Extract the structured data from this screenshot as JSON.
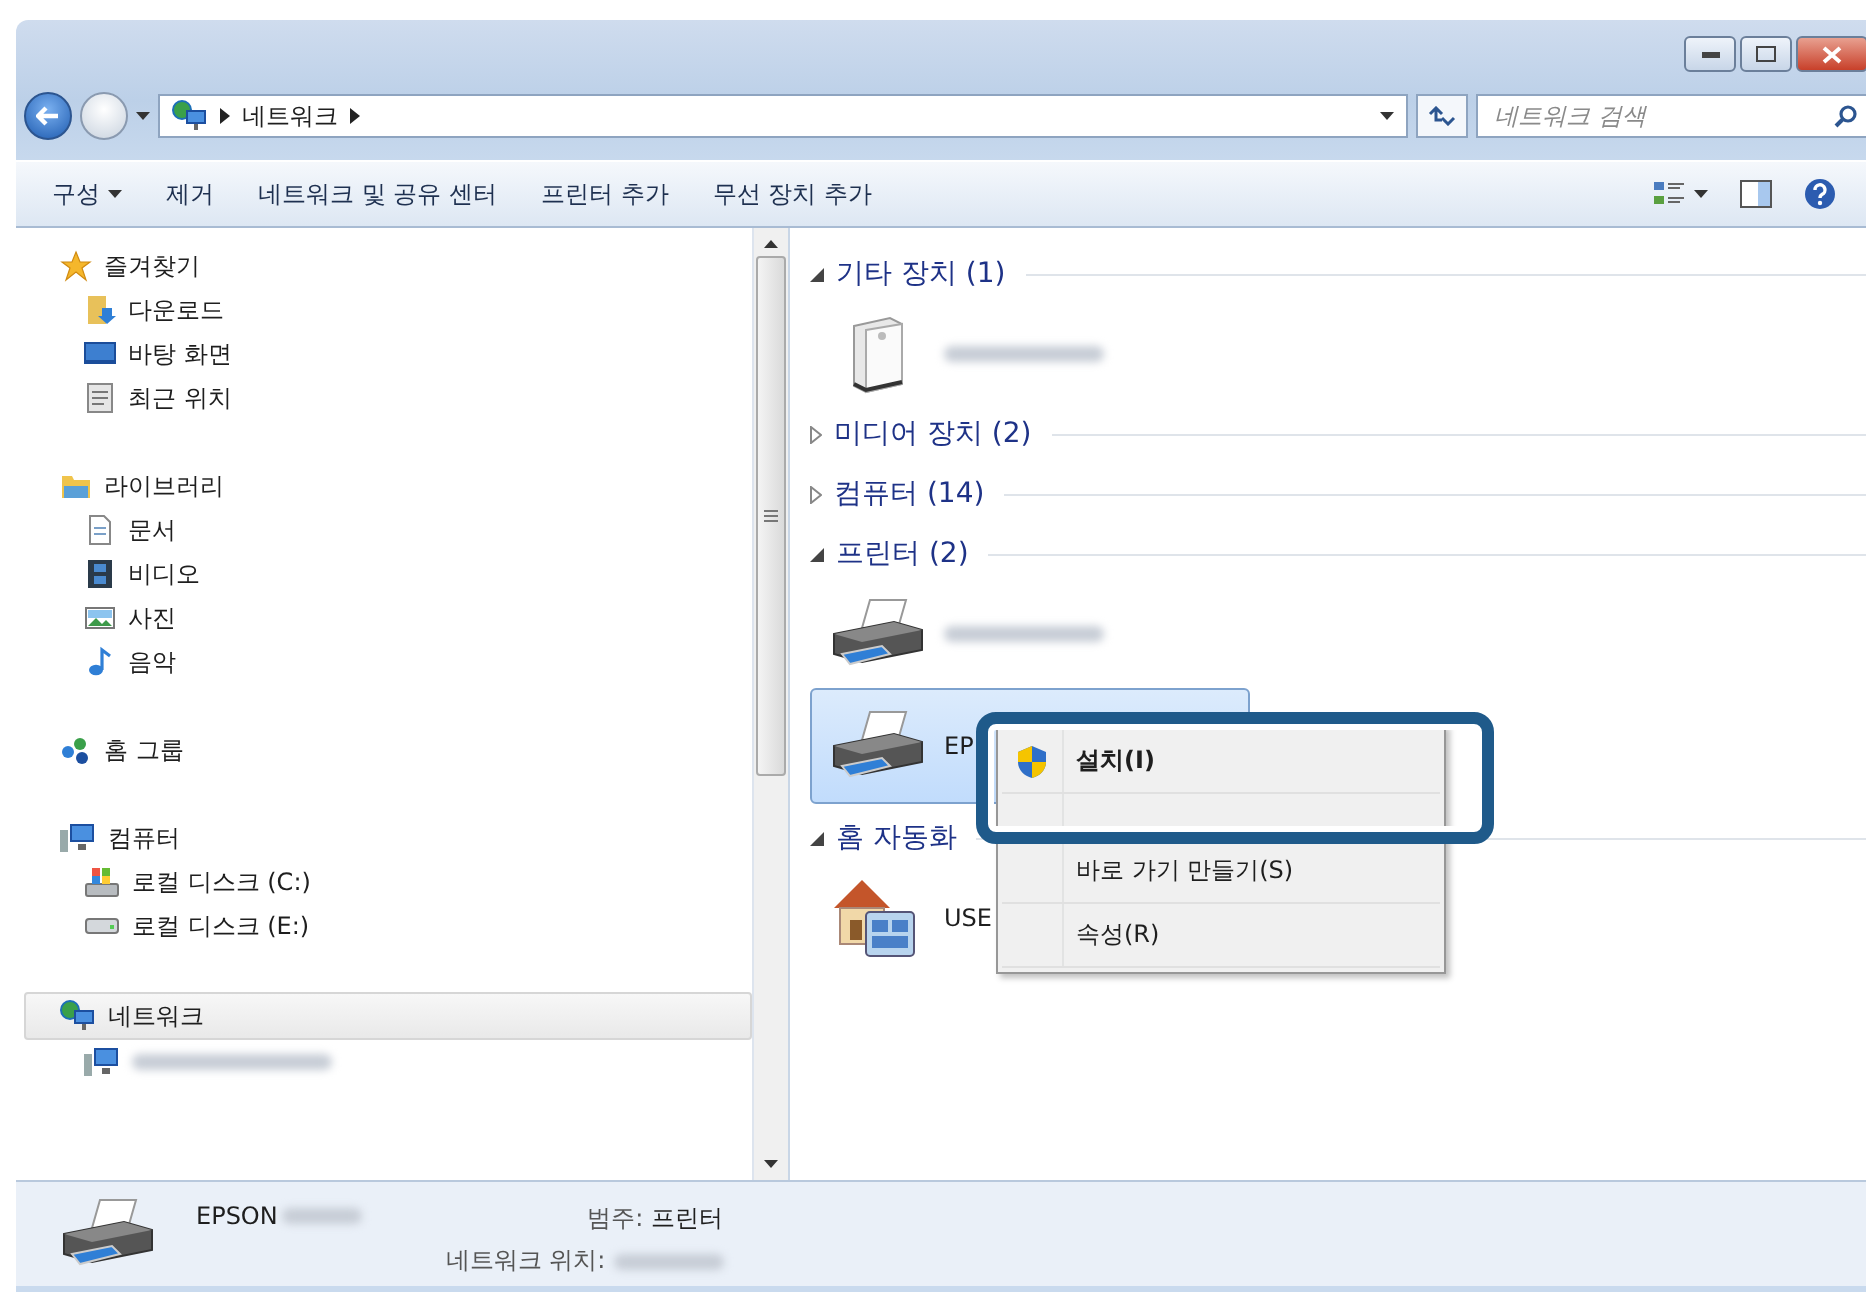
{
  "address": {
    "path": [
      "네트워크"
    ],
    "search_placeholder": "네트워크 검색"
  },
  "toolbar": [
    {
      "label": "구성",
      "has_menu": true
    },
    {
      "label": "제거",
      "has_menu": false
    },
    {
      "label": "네트워크 및 공유 센터",
      "has_menu": false
    },
    {
      "label": "프린터 추가",
      "has_menu": false
    },
    {
      "label": "무선 장치 추가",
      "has_menu": false
    }
  ],
  "navigation": [
    {
      "label": "즐겨찾기",
      "kind": "star",
      "selected": false,
      "children": [
        {
          "label": "다운로드",
          "kind": "download"
        },
        {
          "label": "바탕 화면",
          "kind": "desktop"
        },
        {
          "label": "최근 위치",
          "kind": "recent"
        }
      ]
    },
    {
      "label": "라이브러리",
      "kind": "library",
      "selected": false,
      "children": [
        {
          "label": "문서",
          "kind": "document"
        },
        {
          "label": "비디오",
          "kind": "video"
        },
        {
          "label": "사진",
          "kind": "picture"
        },
        {
          "label": "음악",
          "kind": "music"
        }
      ]
    },
    {
      "label": "홈 그룹",
      "kind": "homegroup",
      "selected": false
    },
    {
      "label": "컴퓨터",
      "kind": "computer",
      "selected": false,
      "children": [
        {
          "label": "로컬 디스크 (C:)",
          "kind": "systemdisk"
        },
        {
          "label": "로컬 디스크 (E:)",
          "kind": "disk"
        }
      ]
    },
    {
      "label": "네트워크",
      "kind": "network",
      "selected": true,
      "children": [
        {
          "kind": "computer",
          "redacted": true
        }
      ]
    }
  ],
  "sections": [
    {
      "title": "기타 장치 (1)",
      "expanded": true,
      "items": [
        {
          "kind": "tower",
          "redacted": true,
          "selected": false
        }
      ]
    },
    {
      "title": "미디어 장치 (2)",
      "expanded": false
    },
    {
      "title": "컴퓨터 (14)",
      "expanded": false
    },
    {
      "title": "프린터 (2)",
      "expanded": true,
      "items": [
        {
          "kind": "printer",
          "redacted": true,
          "selected": false
        },
        {
          "kind": "printer",
          "label": "EP",
          "selected": true
        }
      ]
    },
    {
      "title": "홈 자동화",
      "expanded": true,
      "items": [
        {
          "kind": "house",
          "label": "USE",
          "selected": false
        }
      ]
    }
  ],
  "context_menu": [
    {
      "kind": "shield",
      "label": "설치(I)",
      "default": true
    },
    {
      "kind": "covered"
    },
    {
      "kind": "plain",
      "label": "바로 가기 만들기(S)",
      "default": false
    },
    {
      "kind": "plain",
      "label": "속성(R)",
      "default": false
    }
  ],
  "details": {
    "name": "EPSON",
    "name_redacted": true,
    "fields": [
      {
        "label": "범주:",
        "value": "프린터"
      },
      {
        "label": "네트워크 위치:",
        "redacted": true
      }
    ]
  }
}
